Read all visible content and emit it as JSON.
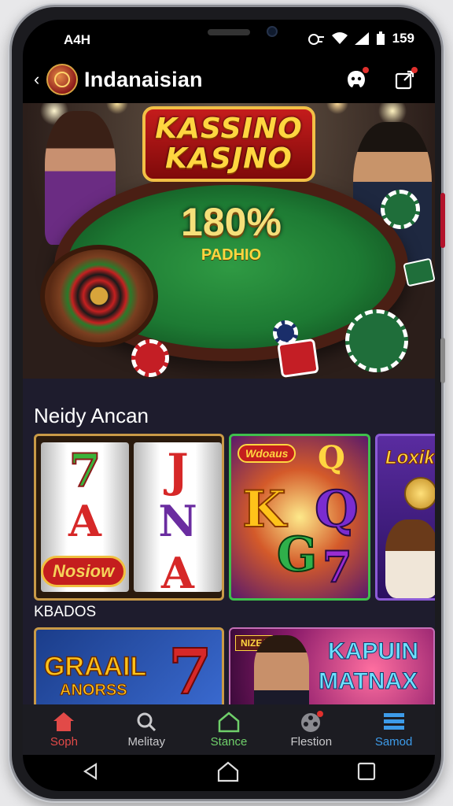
{
  "status_bar": {
    "time": "A4H",
    "battery": "159"
  },
  "app_bar": {
    "back_icon": "chevron-left-icon",
    "title": "Indanaisian",
    "actions": [
      {
        "icon": "alien-icon"
      },
      {
        "icon": "share-box-icon"
      }
    ]
  },
  "hero": {
    "title_line1": "KASSINO",
    "title_line2": "KASJNO",
    "percent": "180%",
    "subtitle": "PADHIO"
  },
  "section1": {
    "title": "Neidy Ancan",
    "cards": [
      {
        "caption": "Nosiow",
        "symbols": [
          "7",
          "J",
          "A",
          "N",
          "A",
          "A"
        ]
      },
      {
        "badge": "Wdoaus",
        "symbols": [
          "K",
          "Q",
          "G",
          "7"
        ]
      },
      {
        "badge": "Loxik"
      }
    ]
  },
  "section2": {
    "label": "KBADOS",
    "cards": [
      {
        "line1": "GRAAIL",
        "line2": "ANORSS"
      },
      {
        "badge": "NIZEJ",
        "line1": "KAPUIN",
        "line2": "MATNAX"
      }
    ]
  },
  "bottom_nav": [
    {
      "label": "Soph",
      "icon": "home-icon",
      "color": "#e24a48"
    },
    {
      "label": "Melitay",
      "icon": "search-icon",
      "color": "#c9c9cc"
    },
    {
      "label": "Stance",
      "icon": "home-outline-icon",
      "color": "#6fcf6a"
    },
    {
      "label": "Flestion",
      "icon": "film-reel-icon",
      "color": "#c9c9cc"
    },
    {
      "label": "Samod",
      "icon": "menu-icon",
      "color": "#3d9be9"
    }
  ],
  "system_nav": [
    {
      "icon": "back-triangle-icon"
    },
    {
      "icon": "home-circle-icon"
    },
    {
      "icon": "recents-square-icon"
    }
  ]
}
